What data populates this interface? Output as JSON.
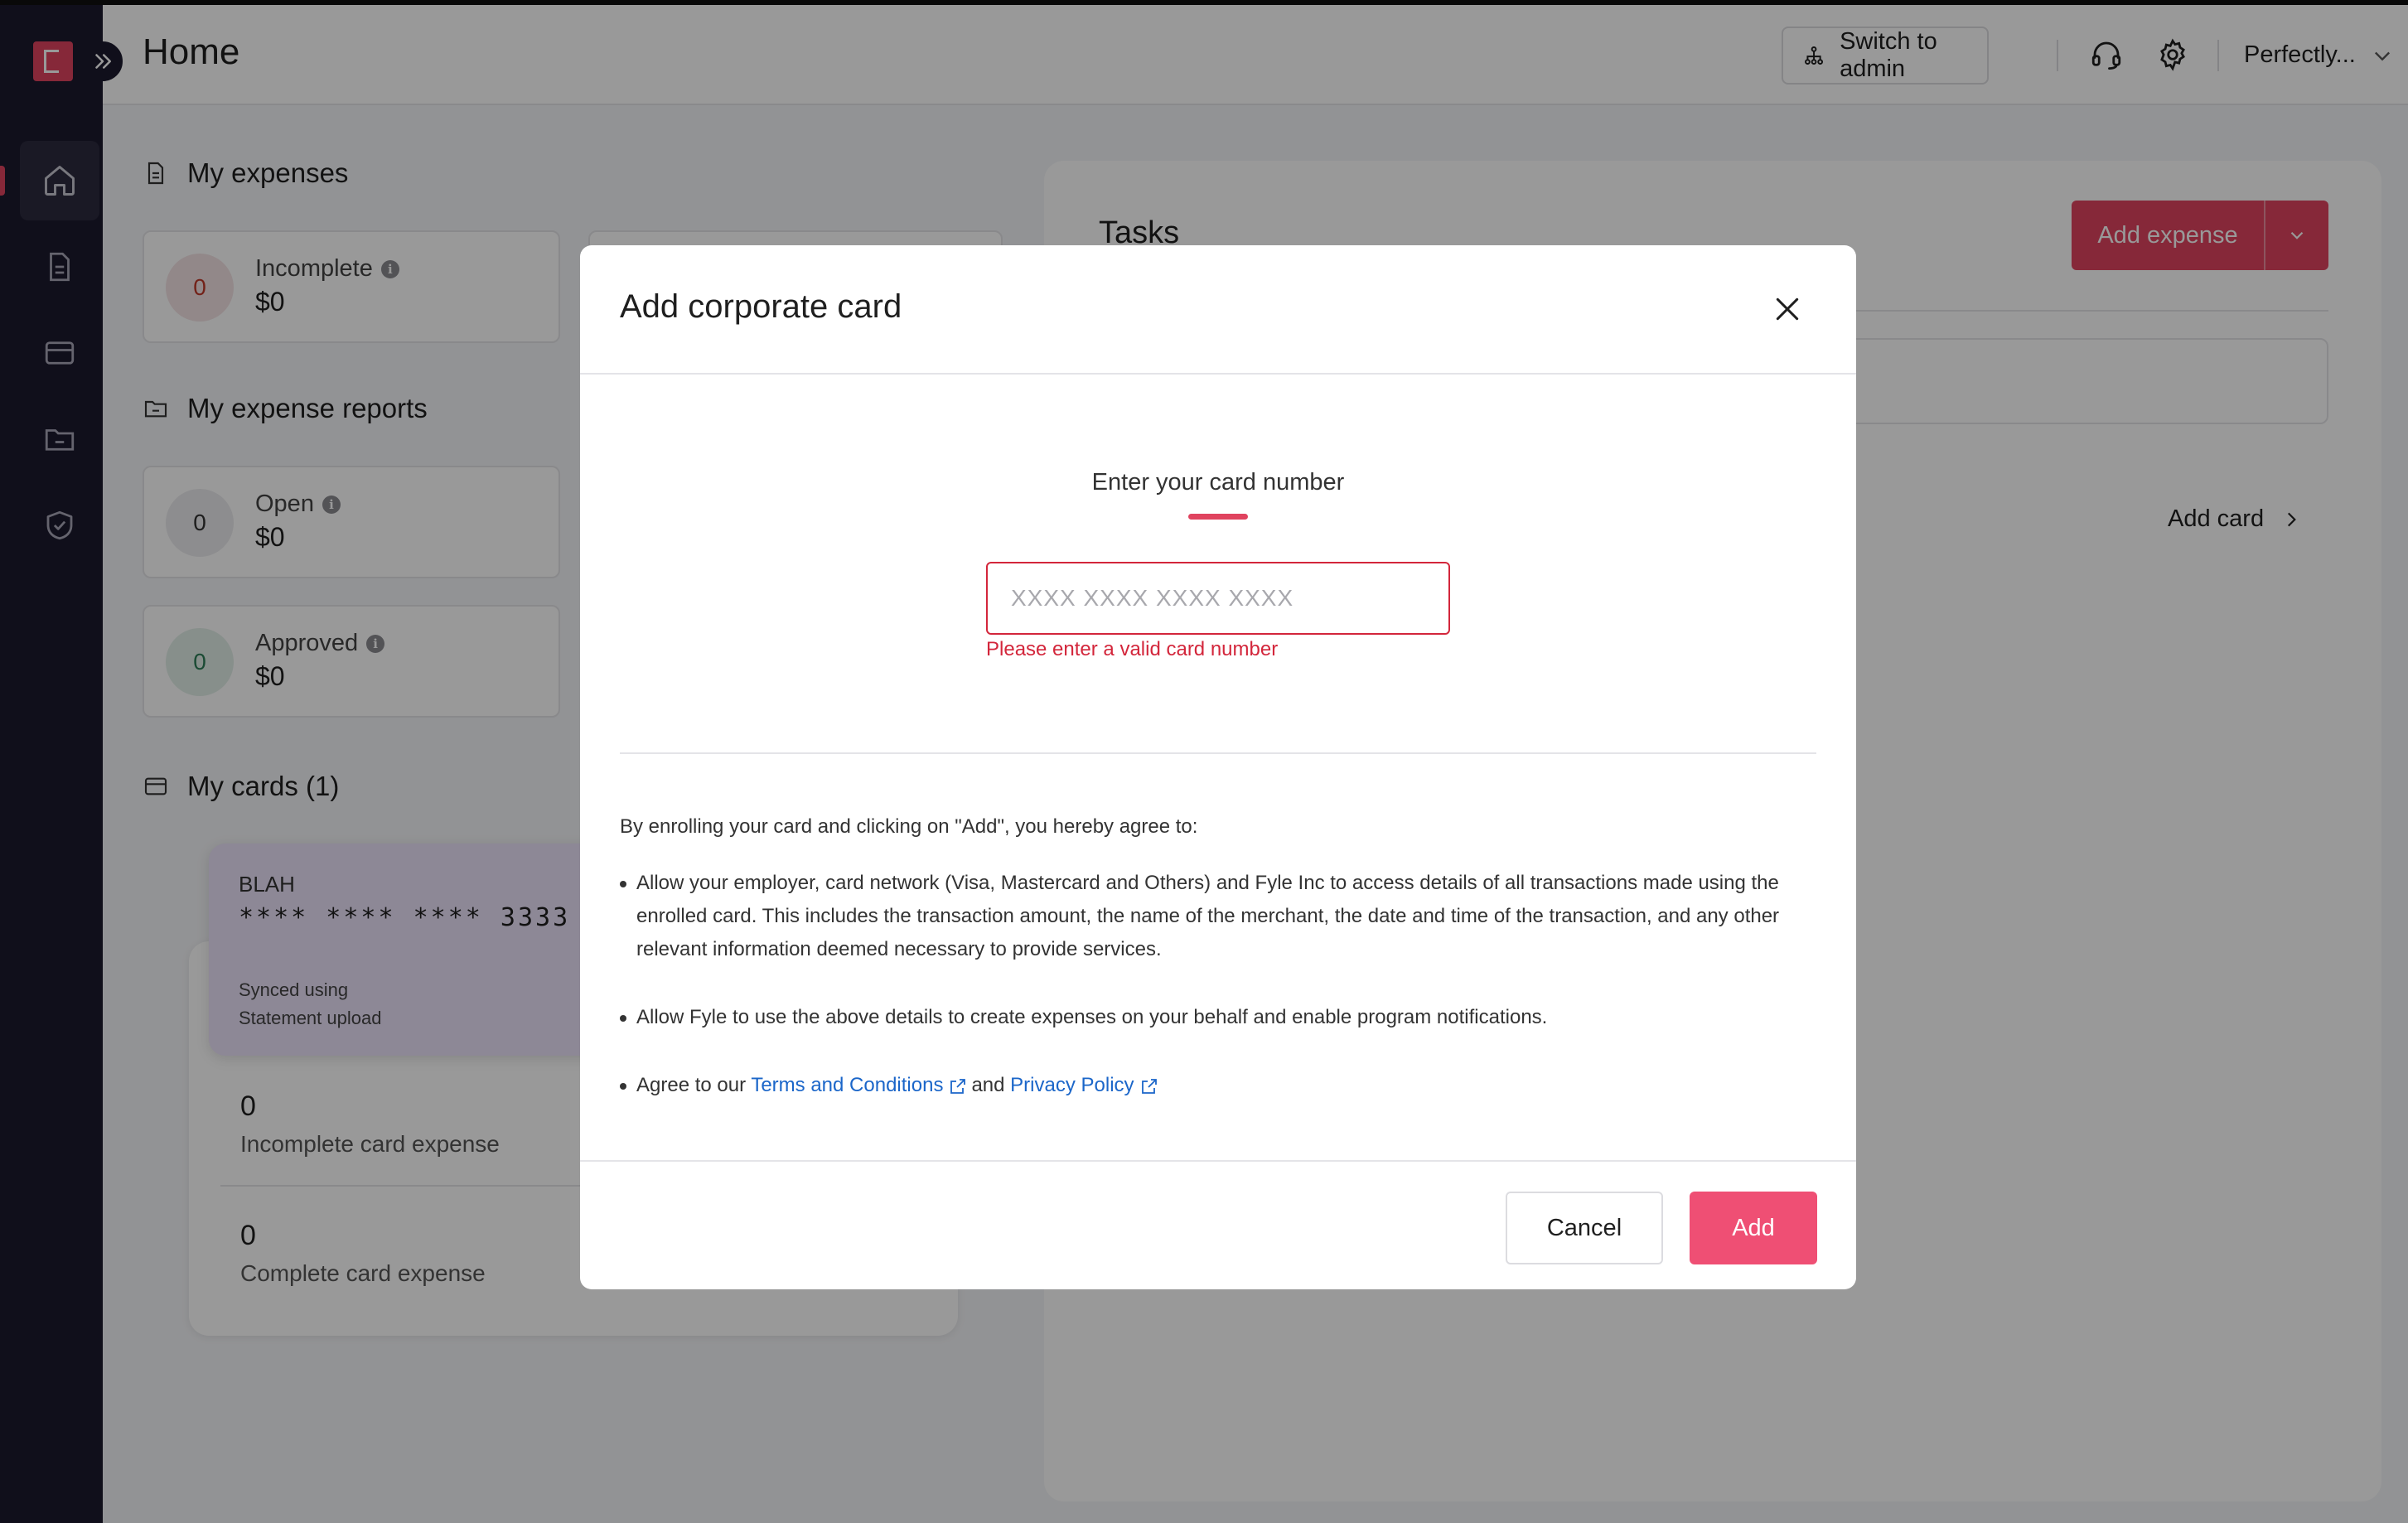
{
  "header": {
    "title": "Home",
    "switch_admin_label": "Switch to admin",
    "user_name": "Perfectly..."
  },
  "sidebar": {
    "items": [
      {
        "name": "home",
        "active": true
      },
      {
        "name": "expenses",
        "active": false
      },
      {
        "name": "cards",
        "active": false
      },
      {
        "name": "reports",
        "active": false
      },
      {
        "name": "approvals",
        "active": false
      }
    ]
  },
  "my_expenses": {
    "title": "My expenses",
    "incomplete": {
      "count": "0",
      "label": "Incomplete",
      "amount": "$0"
    }
  },
  "my_reports": {
    "title": "My expense reports",
    "open": {
      "count": "0",
      "label": "Open",
      "amount": "$0"
    },
    "approved": {
      "count": "0",
      "label": "Approved",
      "amount": "$0"
    }
  },
  "my_cards": {
    "title": "My cards (1)",
    "card": {
      "name": "BLAH",
      "number": "**** **** **** 3333",
      "sync_line1": "Synced using",
      "sync_line2": "Statement upload"
    },
    "incomplete": {
      "count": "0",
      "label": "Incomplete card expense"
    },
    "complete": {
      "count": "0",
      "label": "Complete card expense"
    }
  },
  "tasks": {
    "title": "Tasks",
    "add_expense_label": "Add expense",
    "add_card_label": "Add card"
  },
  "modal": {
    "title": "Add corporate card",
    "prompt": "Enter your card number",
    "input_placeholder": "XXXX XXXX XXXX XXXX",
    "input_value": "",
    "error": "Please enter a valid card number",
    "terms_intro": "By enrolling your card and clicking on \"Add\", you hereby agree to:",
    "terms": [
      "Allow your employer, card network (Visa, Mastercard and Others) and Fyle Inc to access details of all transactions made using the enrolled card. This includes the transaction amount, the name of the merchant, the date and time of the transaction, and any other relevant information deemed necessary to provide services.",
      "Allow Fyle to use the above details to create expenses on your behalf and enable program notifications."
    ],
    "agree_prefix": "Agree to our",
    "terms_link": "Terms and Conditions",
    "agree_and": "and",
    "privacy_link": "Privacy Policy",
    "cancel_label": "Cancel",
    "add_label": "Add"
  },
  "colors": {
    "brand": "#e0435f",
    "add_button": "#ef4f74",
    "error": "#d3263b",
    "link": "#1b66c9",
    "sidebar": "#1c1a2e"
  }
}
